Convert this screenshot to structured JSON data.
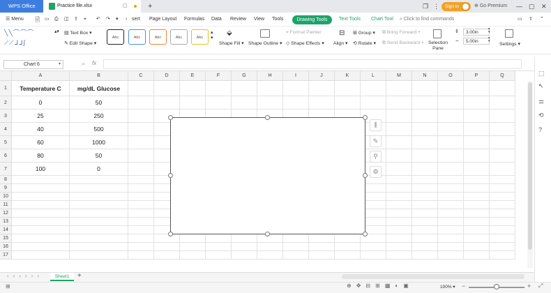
{
  "titlebar": {
    "app_tab": "WPS Office",
    "file_tab": "Practice file.xlsx",
    "sign_in": "Sign in",
    "premium": "Go Premium",
    "add_tab": "+"
  },
  "menu": {
    "items": [
      "sert",
      "Page Layout",
      "Formulas",
      "Data",
      "Review",
      "View",
      "Tools",
      "Drawing Tools",
      "Text Tools",
      "Chart Tool"
    ],
    "search": "Click to find commands",
    "app_menu": "Menu"
  },
  "ribbon": {
    "text_box": "Text Box",
    "edit_shape": "Edit Shape",
    "style_label": "Abc",
    "shape_fill": "Shape Fill",
    "shape_outline": "Shape Outline",
    "format_painter": "Format Painter",
    "shape_effects": "Shape Effects",
    "align": "Align",
    "group": "Group",
    "rotate": "Rotate",
    "bring_forward": "Bring Forward",
    "send_backward": "Send Backward",
    "selection_pane": "Selection Pane",
    "height": "3.00in",
    "width": "5.00in",
    "settings": "Settings"
  },
  "formula_bar": {
    "name_box": "Chart 6",
    "fx": "fx",
    "value": ""
  },
  "grid": {
    "columns": [
      "A",
      "B",
      "C",
      "D",
      "E",
      "F",
      "G",
      "H",
      "I",
      "J",
      "K",
      "L",
      "M",
      "N",
      "O",
      "P",
      "Q"
    ],
    "rows": [
      "1",
      "2",
      "3",
      "4",
      "5",
      "6",
      "7",
      "8",
      "9",
      "10",
      "11",
      "12",
      "13",
      "14",
      "15",
      "16",
      "17"
    ],
    "headers": [
      "Temperature C",
      "mg/dL Glucose"
    ],
    "data": [
      [
        "0",
        "50"
      ],
      [
        "25",
        "250"
      ],
      [
        "40",
        "500"
      ],
      [
        "60",
        "1000"
      ],
      [
        "80",
        "50"
      ],
      [
        "100",
        "0"
      ]
    ]
  },
  "sheet_tabs": {
    "active": "Sheet1"
  },
  "status": {
    "zoom": "100%"
  }
}
